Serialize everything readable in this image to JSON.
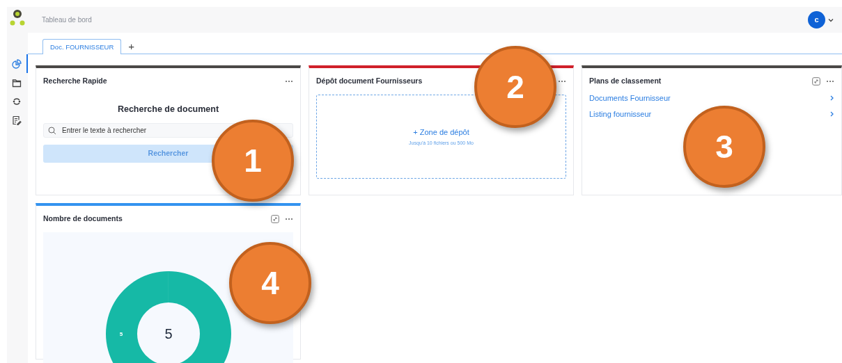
{
  "header": {
    "title": "Tableau de bord",
    "avatar": "c"
  },
  "sidebar": {
    "items": [
      {
        "selected": true
      },
      {
        "selected": false
      },
      {
        "selected": false
      },
      {
        "selected": false
      }
    ]
  },
  "tabs": [
    {
      "label": "Doc. FOURNISSEUR",
      "selected": true
    }
  ],
  "tab_add": "+",
  "widgets": [
    {
      "kind": "search",
      "title": "Recherche Rapide",
      "color": "#4a4846",
      "callout": "1",
      "heading": "Recherche de document",
      "placeholder": "Entrer le texte à rechercher",
      "button": "Rechercher",
      "expand": false
    },
    {
      "kind": "upload",
      "title": "Dépôt document Fournisseurs",
      "color": "#d0202a",
      "callout": "2",
      "drop_label": "+ Zone de dépôt",
      "drop_hint": "Jusqu'à 10 fichiers ou 500 Mo",
      "expand": false
    },
    {
      "kind": "links",
      "title": "Plans de classement",
      "color": "#4a4846",
      "callout": "3",
      "links": [
        "Documents Fournisseur",
        "Listing fournisseur"
      ],
      "expand": true
    },
    {
      "kind": "chart",
      "title": "Nombre de documents",
      "color": "#3393f0",
      "callout": "4",
      "total": "5",
      "slice_label": "5",
      "expand": true
    }
  ]
}
